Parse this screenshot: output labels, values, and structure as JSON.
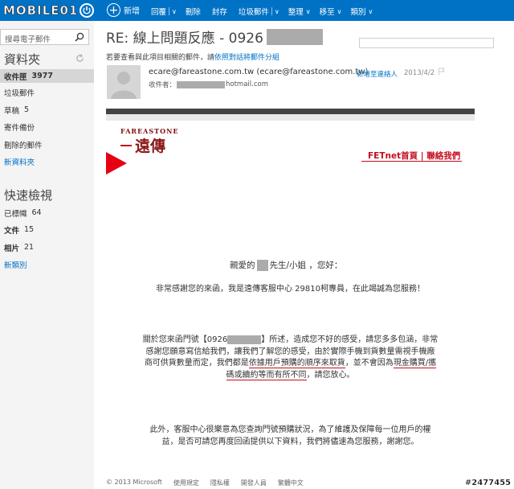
{
  "logo": {
    "text": "MOBILE01"
  },
  "toolbar": {
    "new_label": "新增",
    "commands": [
      "回覆",
      "刪除",
      "封存",
      "垃圾郵件",
      "整理",
      "移至",
      "類別"
    ]
  },
  "nav": {
    "search_placeholder": "搜尋電子郵件",
    "folders_heading": "資料夾",
    "folders": [
      {
        "label": "收件匣",
        "count": "3977"
      },
      {
        "label": "垃圾郵件",
        "count": ""
      },
      {
        "label": "草稿",
        "count": "5"
      },
      {
        "label": "寄件備份",
        "count": ""
      },
      {
        "label": "刪除的郵件",
        "count": ""
      }
    ],
    "new_folder": "新資料夾",
    "quick_heading": "快速檢視",
    "quick_items": [
      {
        "label": "已標幟",
        "count": "64"
      },
      {
        "label": "文件",
        "count": "15"
      },
      {
        "label": "相片",
        "count": "21"
      }
    ],
    "new_category": "新類別"
  },
  "message": {
    "subject_prefix": "RE: 線上問題反應 - 0926",
    "notice_text": "若要查看與此項目相關的郵件，請",
    "notice_link": "依照對話將郵件分組",
    "sender": "ecare@fareastone.com.tw (ecare@fareastone.com.tw)",
    "recipient_label": "收件者：",
    "recipient_domain": "hotmail.com",
    "add_contact": "新增至連絡人",
    "date": "2013/4/2"
  },
  "email": {
    "brand_en": "FAREASTONE",
    "brand_zh": "遠傳",
    "links": "FETnet首頁 | 聯絡我們",
    "greeting_pre": "親愛的",
    "greeting_post": "先生/小姐 ，您好：",
    "p1": "非常感謝您的來函，我是遠傳客服中心 29810柯專員，在此竭誠為您服務！",
    "p2_a": "關於您來函門號【0926",
    "p2_b": "】所述，造成您不好的感受，請您多多包涵，非常",
    "p2_c": "感謝您願意寫信給我們，讓我們了解您的感受，由於實際手機到貨數量需視手機廠",
    "p2_d1": "商可供貨數量而定，我們都是",
    "p2_d2": "依據用戶預購的順序來取貨",
    "p2_d3": "，並不會因為",
    "p2_d4": "現金購買/攜",
    "p2_e1": "碼或續約等而有所不同",
    "p2_e2": "，請您放心。",
    "p3_a": "此外，客服中心很樂意為您查詢門號預購狀況，為了維護及保障每一位用戶的權",
    "p3_b": "益，是否可請您再度回函提供以下資料，我們將儘速為您服務，謝謝您。"
  },
  "footer": [
    "© 2013 Microsoft",
    "使用規定",
    "隱私權",
    "開發人員",
    "繁體中文"
  ],
  "watermark": "#2477455",
  "colors": {
    "accent": "#0072c6",
    "brand_red": "#c40d1e"
  }
}
